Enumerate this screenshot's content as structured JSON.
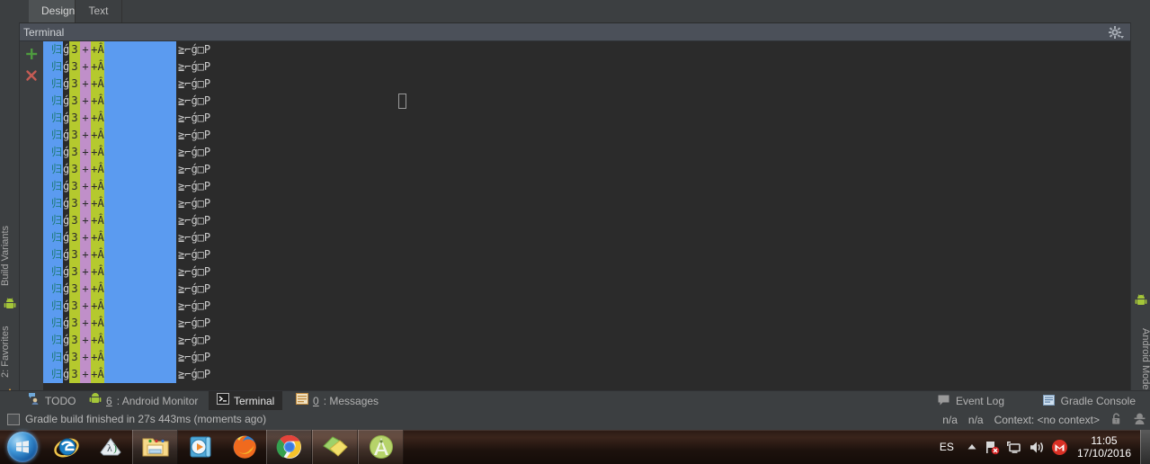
{
  "editor_tabs": [
    {
      "label": "Design",
      "selected": true
    },
    {
      "label": "Text",
      "selected": false
    }
  ],
  "tool_window": {
    "title": "Terminal",
    "settings_icon": "gear-icon",
    "dropdown_icon": "chevron-down-icon",
    "hide_icon": "hide-window-icon"
  },
  "terminal": {
    "new_session_icon": "plus-icon",
    "close_session_icon": "close-x-icon",
    "new_session_color": "#4e9a3f",
    "close_session_color": "#c45b54",
    "cursor": "text-cursor",
    "row_count": 20,
    "row_text": {
      "cyan": "归",
      "dark1": "ǵ",
      "olive1": "3",
      "violet": "+",
      "olive2": "+Â",
      "tail": "≧⌐ǵ□P"
    },
    "colors": {
      "background": "#2b2b2b",
      "blue_block": "#5b9bf0",
      "olive_block": "#b5c92e",
      "violet_block": "#c08fc9",
      "cyan_text": "#1d7a78",
      "tail_text": "#cfcfcf"
    }
  },
  "left_bar": [
    {
      "label": "Build Variants",
      "icon": "android-icon"
    },
    {
      "label": "2: Favorites",
      "icon": "star-icon"
    }
  ],
  "right_bar": [
    {
      "label": "Android Model",
      "icon": "android-icon"
    }
  ],
  "bottom_tabs": [
    {
      "label": "TODO",
      "prefix": "",
      "icon": "todo-icon",
      "selected": false
    },
    {
      "label": ": Android Monitor",
      "prefix": "6",
      "icon": "android-icon",
      "selected": false
    },
    {
      "label": "Terminal",
      "prefix": "",
      "icon": "terminal-icon",
      "selected": true
    },
    {
      "label": ": Messages",
      "prefix": "0",
      "icon": "messages-icon",
      "selected": false
    }
  ],
  "bottom_right": [
    {
      "label": "Event Log",
      "icon": "event-log-icon"
    },
    {
      "label": "Gradle Console",
      "icon": "gradle-console-icon"
    }
  ],
  "status_bar": {
    "build_icon": "build-status-icon",
    "message": "Gradle build finished in 27s 443ms (moments ago)",
    "memory": "n/a",
    "line_col": "n/a",
    "context": "Context: <no context>",
    "lock_icon": "lock-icon",
    "hector_icon": "hector-icon"
  },
  "taskbar": {
    "start_button": "windows-start-orb",
    "items": [
      {
        "name": "internet-explorer-icon",
        "running": false
      },
      {
        "name": "lambda-app-icon",
        "running": false
      },
      {
        "name": "file-explorer-icon",
        "running": true
      },
      {
        "name": "media-player-icon",
        "running": false
      },
      {
        "name": "firefox-icon",
        "running": false
      },
      {
        "name": "google-chrome-icon",
        "running": true
      },
      {
        "name": "sticky-notes-icon",
        "running": true
      },
      {
        "name": "android-studio-icon",
        "running": true
      }
    ],
    "tray": {
      "language": "ES",
      "show_hidden_icon": "chevron-up-icon",
      "action_center_icon": "action-center-flag-icon",
      "network_icon": "network-icon",
      "volume_icon": "volume-icon",
      "gmail_icon": "gmail-icon",
      "time": "11:05",
      "date": "17/10/2016"
    }
  }
}
